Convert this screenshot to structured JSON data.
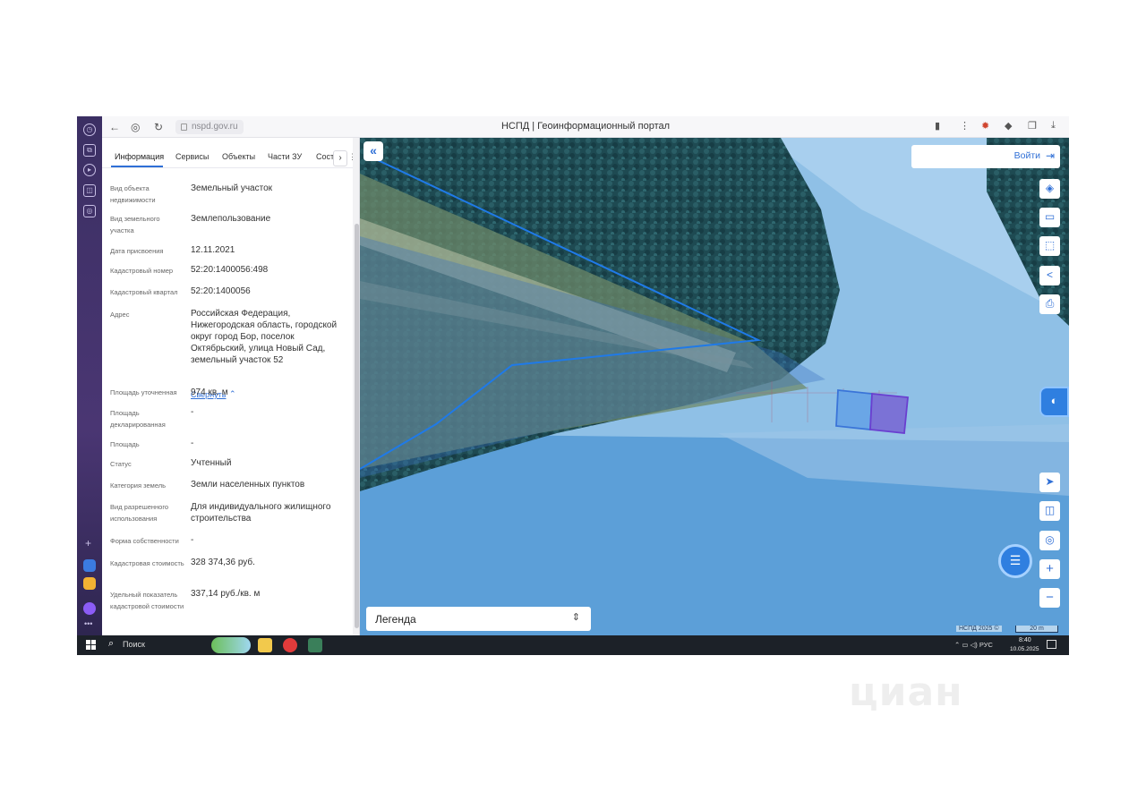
{
  "browser": {
    "url": "nspd.gov.ru",
    "title": "НСПД | Геоинформационный портал"
  },
  "panel": {
    "tabs": [
      {
        "label": "Информация",
        "active": true
      },
      {
        "label": "Сервисы"
      },
      {
        "label": "Объекты"
      },
      {
        "label": "Части ЗУ"
      },
      {
        "label": "Сості"
      }
    ],
    "fields": [
      {
        "label": "Вид объекта недвижимости",
        "value": "Земельный участок"
      },
      {
        "label": "Вид земельного участка",
        "value": "Землепользование"
      },
      {
        "label": "Дата присвоения",
        "value": "12.11.2021"
      },
      {
        "label": "Кадастровый номер",
        "value": "52:20:1400056:498"
      },
      {
        "label": "Кадастровый квартал",
        "value": "52:20:1400056"
      },
      {
        "label": "Адрес",
        "value": "Российская Федерация, Нижегородская область, городской округ город Бор, поселок Октябрьский, улица Новый Сад, земельный участок 52"
      },
      {
        "label": "Площадь уточненная",
        "value": "974 кв. м"
      },
      {
        "label": "Площадь декларированная",
        "value": "-"
      },
      {
        "label": "Площадь",
        "value": "-"
      },
      {
        "label": "Статус",
        "value": "Учтенный"
      },
      {
        "label": "Категория земель",
        "value": "Земли населенных пунктов"
      },
      {
        "label": "Вид разрешенного использования",
        "value": "Для индивидуального жилищного строительства"
      },
      {
        "label": "Форма собственности",
        "value": "-"
      },
      {
        "label": "Кадастровая стоимость",
        "value": "328 374,36 руб."
      },
      {
        "label": "Удельный показатель кадастровой стоимости",
        "value": "337,14 руб./кв. м"
      }
    ],
    "collapse_label": "Свернуть"
  },
  "map": {
    "login_label": "Войти",
    "legend_label": "Легенда",
    "copyright": "НСПД 2025 ©",
    "scale_label": "20 m"
  },
  "taskbar": {
    "search_label": "Поиск",
    "language": "РУС",
    "time": "8:40",
    "date": "10.05.2025"
  },
  "watermark": "циан",
  "colors": {
    "accent": "#2f6fd6",
    "parcel_selected": "#7b72d6",
    "parcel_outline": "#3a74d8"
  }
}
